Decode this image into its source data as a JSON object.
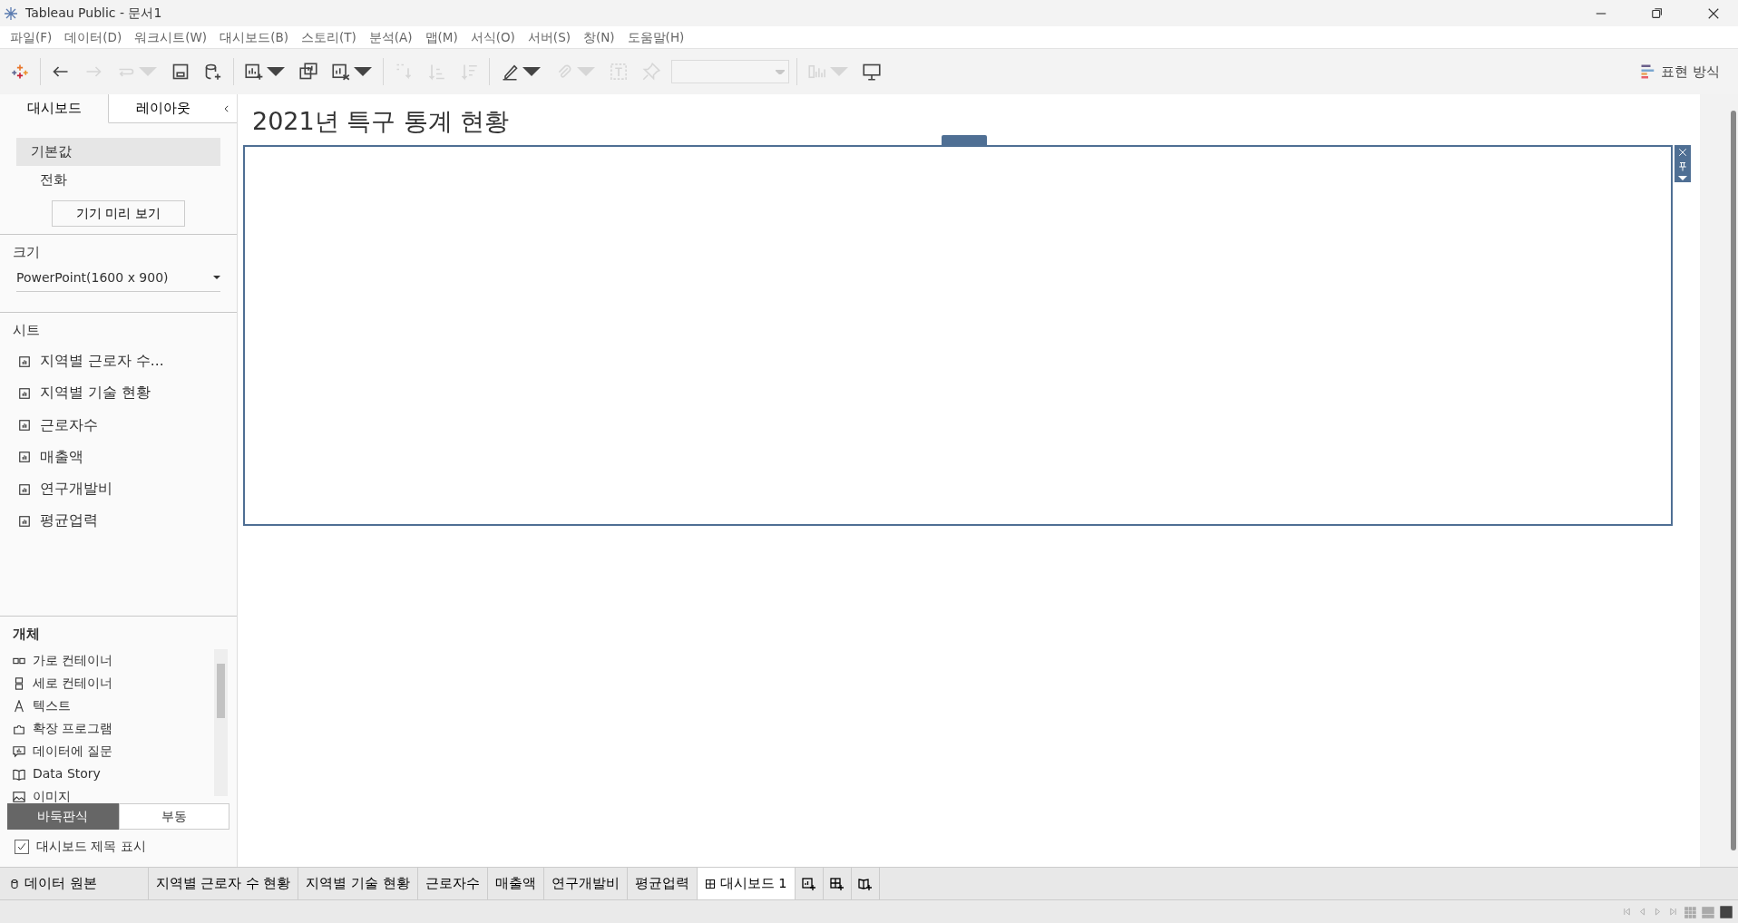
{
  "window": {
    "title": "Tableau Public - 문서1"
  },
  "menu": [
    "파일(F)",
    "데이터(D)",
    "워크시트(W)",
    "대시보드(B)",
    "스토리(T)",
    "분석(A)",
    "맵(M)",
    "서식(O)",
    "서버(S)",
    "창(N)",
    "도움말(H)"
  ],
  "toolbar": {
    "groups": [
      [
        {
          "kind": "logo",
          "disabled": false,
          "menu": false
        }
      ],
      [
        {
          "kind": "undo",
          "disabled": false,
          "menu": false
        },
        {
          "kind": "redo",
          "disabled": true,
          "menu": false
        },
        {
          "kind": "replay",
          "disabled": true,
          "menu": true
        },
        {
          "kind": "save",
          "disabled": false,
          "menu": false
        },
        {
          "kind": "new-datasource",
          "disabled": false,
          "menu": false
        }
      ],
      [
        {
          "kind": "new-sheet",
          "disabled": false,
          "menu": true
        },
        {
          "kind": "duplicate",
          "disabled": false,
          "menu": false
        },
        {
          "kind": "clear",
          "disabled": false,
          "menu": true
        }
      ],
      [
        {
          "kind": "swap",
          "disabled": true,
          "menu": false
        },
        {
          "kind": "sort-asc",
          "disabled": true,
          "menu": false
        },
        {
          "kind": "sort-desc",
          "disabled": true,
          "menu": false
        }
      ],
      [
        {
          "kind": "highlight",
          "disabled": false,
          "menu": true
        },
        {
          "kind": "group",
          "disabled": true,
          "menu": true
        },
        {
          "kind": "label",
          "disabled": true,
          "menu": false
        },
        {
          "kind": "pin",
          "disabled": true,
          "menu": false
        },
        {
          "kind": "fit",
          "disabled": true
        }
      ],
      [
        {
          "kind": "cards",
          "disabled": true,
          "menu": true
        },
        {
          "kind": "presentation",
          "disabled": false,
          "menu": false
        }
      ]
    ],
    "show_me": {
      "label": "표현 방식"
    }
  },
  "sidebar": {
    "tabs": [
      {
        "label": "대시보드",
        "selected": true
      },
      {
        "label": "레이아웃",
        "selected": false
      }
    ],
    "devices": [
      {
        "label": "기본값",
        "selected": true
      },
      {
        "label": "전화",
        "selected": false
      }
    ],
    "preview_button": "기기 미리 보기",
    "size": {
      "heading": "크기",
      "value": "PowerPoint(1600 x 900)"
    },
    "sheets": {
      "heading": "시트",
      "items": [
        "지역별 근로자 수...",
        "지역별 기술 현황",
        "근로자수",
        "매출액",
        "연구개발비",
        "평균업력"
      ]
    },
    "objects": {
      "heading": "개체",
      "items": [
        {
          "kind": "horizontal",
          "label": "가로 컨테이너"
        },
        {
          "kind": "vertical",
          "label": "세로 컨테이너"
        },
        {
          "kind": "text",
          "label": "텍스트"
        },
        {
          "kind": "extension",
          "label": "확장 프로그램"
        },
        {
          "kind": "ask-data",
          "label": "데이터에 질문"
        },
        {
          "kind": "data-story",
          "label": "Data Story"
        },
        {
          "kind": "image",
          "label": "이미지"
        }
      ]
    },
    "layout_mode": [
      {
        "label": "바둑판식",
        "selected": true
      },
      {
        "label": "부동",
        "selected": false
      }
    ],
    "show_title": {
      "label": "대시보드 제목 표시",
      "checked": true
    }
  },
  "canvas": {
    "title": "2021년 특구 통계 현황"
  },
  "sheet_tabs": [
    {
      "kind": "datasource",
      "label": "데이터 원본",
      "selected": false
    },
    {
      "kind": "sheet",
      "label": "지역별 근로자 수 현황",
      "selected": false
    },
    {
      "kind": "sheet",
      "label": "지역별 기술 현황",
      "selected": false
    },
    {
      "kind": "sheet",
      "label": "근로자수",
      "selected": false
    },
    {
      "kind": "sheet",
      "label": "매출액",
      "selected": false
    },
    {
      "kind": "sheet",
      "label": "연구개발비",
      "selected": false
    },
    {
      "kind": "sheet",
      "label": "평균업력",
      "selected": false
    },
    {
      "kind": "dashboard",
      "label": "대시보드 1",
      "selected": true
    }
  ],
  "add_buttons": [
    {
      "kind": "worksheet"
    },
    {
      "kind": "dashboard"
    },
    {
      "kind": "story"
    }
  ]
}
